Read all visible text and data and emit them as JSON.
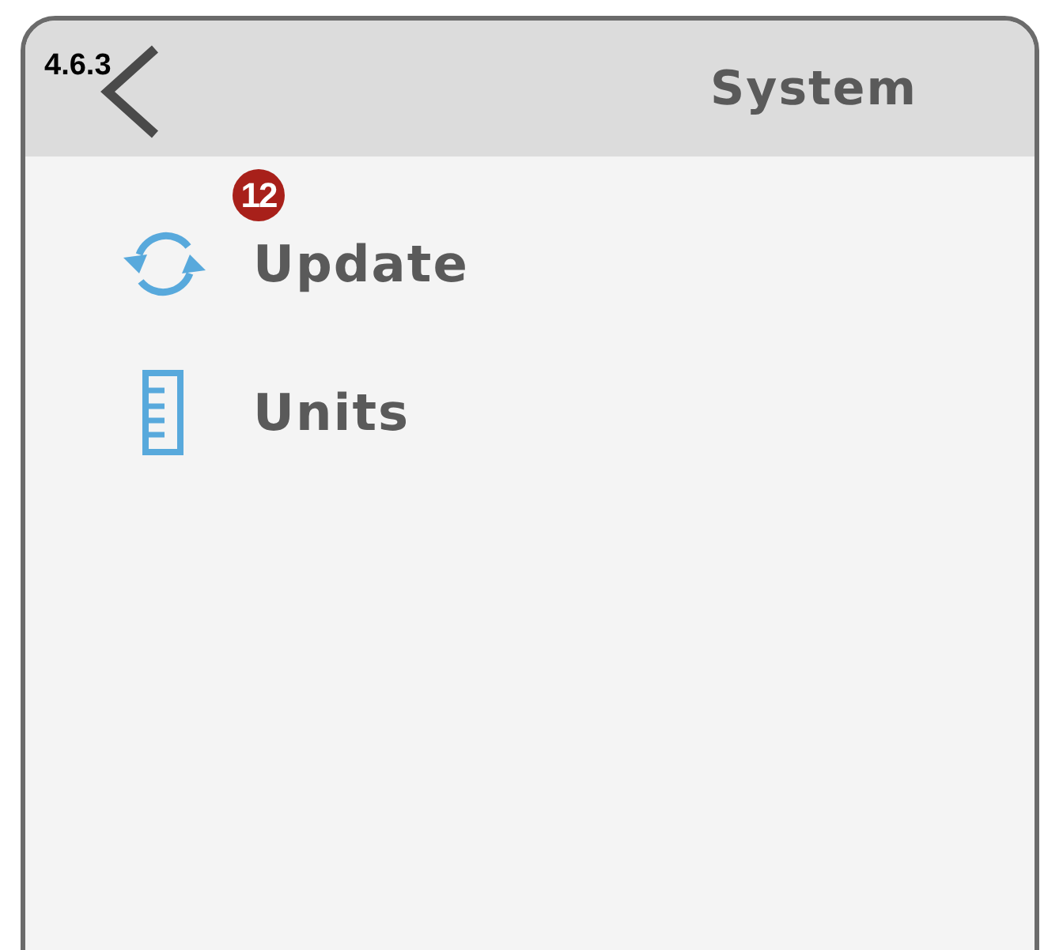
{
  "figure_label": "4.6.3",
  "header": {
    "title": "System"
  },
  "callout": "12",
  "items": [
    {
      "kind": "update",
      "label": "Update"
    },
    {
      "kind": "units",
      "label": "Units"
    }
  ]
}
